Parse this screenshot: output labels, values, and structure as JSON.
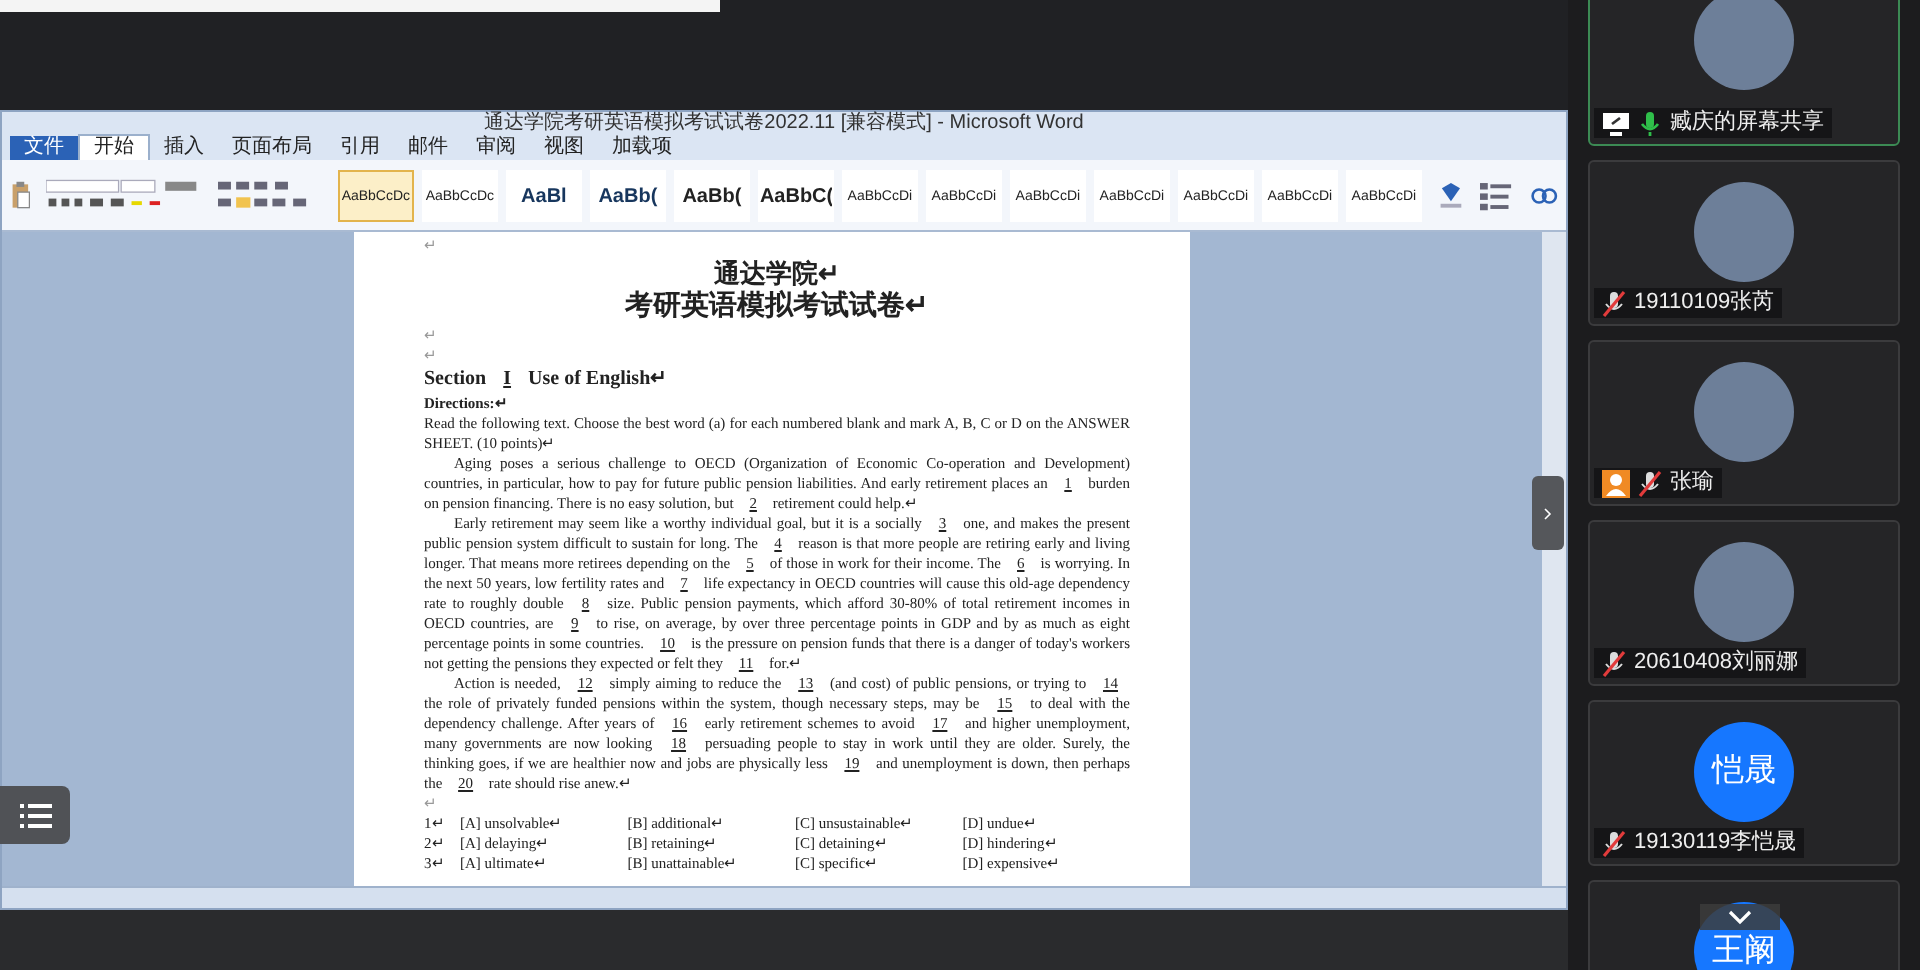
{
  "word": {
    "title": "通达学院考研英语模拟考试试卷2022.11 [兼容模式] - Microsoft Word",
    "tabs": [
      {
        "label": "文件",
        "kind": "file",
        "selected": false
      },
      {
        "label": "开始",
        "kind": "tab",
        "selected": true
      },
      {
        "label": "插入",
        "kind": "tab",
        "selected": false
      },
      {
        "label": "页面布局",
        "kind": "tab",
        "selected": false
      },
      {
        "label": "引用",
        "kind": "tab",
        "selected": false
      },
      {
        "label": "邮件",
        "kind": "tab",
        "selected": false
      },
      {
        "label": "审阅",
        "kind": "tab",
        "selected": false
      },
      {
        "label": "视图",
        "kind": "tab",
        "selected": false
      },
      {
        "label": "加载项",
        "kind": "tab",
        "selected": false
      }
    ],
    "styles": [
      {
        "preview": "AaBbCcDc",
        "selected": true
      },
      {
        "preview": "AaBbCcDc",
        "selected": false
      },
      {
        "preview": "AaBl",
        "selected": false
      },
      {
        "preview": "AaBb(",
        "selected": false
      },
      {
        "preview": "AaBb(",
        "selected": false
      },
      {
        "preview": "AaBbC(",
        "selected": false
      },
      {
        "preview": "AaBbCcDi",
        "selected": false
      },
      {
        "preview": "AaBbCcDi",
        "selected": false
      },
      {
        "preview": "AaBbCcDi",
        "selected": false
      },
      {
        "preview": "AaBbCcDi",
        "selected": false
      },
      {
        "preview": "AaBbCcDi",
        "selected": false
      },
      {
        "preview": "AaBbCcDi",
        "selected": false
      },
      {
        "preview": "AaBbCcDi",
        "selected": false
      }
    ],
    "document": {
      "top_mark": "↵",
      "school": "通达学院↵",
      "exam_title": "考研英语模拟考试试卷↵",
      "gap_marks": [
        "↵",
        "↵"
      ],
      "section": [
        {
          "text": "Section "
        },
        {
          "blank": "I"
        },
        {
          "text": " Use of English↵"
        }
      ],
      "directions_heading": "Directions:↵",
      "directions": "Read the following text. Choose the best word (a) for each numbered blank and mark A, B, C or D on the ANSWER SHEET. (10 points)↵",
      "paragraphs": [
        [
          {
            "text": "Aging poses a serious challenge to OECD (Organization of Economic Co-operation and Development) countries, in particular, how to pay for future public pension liabilities. And early retirement places an "
          },
          {
            "blank": "1"
          },
          {
            "text": " burden on pension financing. There is no easy solution, but "
          },
          {
            "blank": "2"
          },
          {
            "text": " retirement could help.↵"
          }
        ],
        [
          {
            "text": "Early retirement may seem like a worthy individual goal, but it is a socially "
          },
          {
            "blank": "3"
          },
          {
            "text": " one, and makes the present public pension system difficult to sustain for long. The "
          },
          {
            "blank": "4"
          },
          {
            "text": " reason is that more people are retiring early and living longer. That means more retirees depending on the "
          },
          {
            "blank": "5"
          },
          {
            "text": " of those in work for their income. The "
          },
          {
            "blank": "6"
          },
          {
            "text": " is worrying. In the next 50 years, low fertility rates and "
          },
          {
            "blank": "7"
          },
          {
            "text": " life expectancy in OECD countries will cause this old-age dependency rate to roughly double "
          },
          {
            "blank": "8"
          },
          {
            "text": " size. Public pension payments, which afford 30-80% of total retirement incomes in OECD countries, are "
          },
          {
            "blank": "9"
          },
          {
            "text": " to rise, on average, by over three percentage points in GDP and by as much as eight percentage points in some countries. "
          },
          {
            "blank": "10"
          },
          {
            "text": " is the pressure on pension funds that there is a danger of today's workers not getting the pensions they expected or felt they "
          },
          {
            "blank": "11"
          },
          {
            "text": " for.↵"
          }
        ],
        [
          {
            "text": "Action is needed, "
          },
          {
            "blank": "12"
          },
          {
            "text": " simply aiming to reduce the "
          },
          {
            "blank": "13"
          },
          {
            "text": " (and cost) of public pensions, or trying to "
          },
          {
            "blank": "14"
          },
          {
            "text": " the role of privately funded pensions within the system, though necessary steps, may be "
          },
          {
            "blank": "15"
          },
          {
            "text": " to deal with the dependency challenge. After years of "
          },
          {
            "blank": "16"
          },
          {
            "text": " early retirement schemes to avoid "
          },
          {
            "blank": "17"
          },
          {
            "text": " and higher unemployment, many governments are now looking "
          },
          {
            "blank": "18"
          },
          {
            "text": " persuading people to stay in work until they are older. Surely, the thinking goes, if we are healthier now and jobs are physically less "
          },
          {
            "blank": "19"
          },
          {
            "text": " and unemployment is down, then perhaps the "
          },
          {
            "blank": "20"
          },
          {
            "text": " rate should rise anew.↵"
          }
        ]
      ],
      "options_mark": "↵",
      "options": [
        {
          "number": "1↵",
          "choices": [
            "[A] unsolvable↵",
            "[B] additional↵",
            "[C] unsustainable↵",
            "[D] undue↵"
          ]
        },
        {
          "number": "2↵",
          "choices": [
            "[A] delaying↵",
            "[B] retaining↵",
            "[C] detaining↵",
            "[D] hindering↵"
          ]
        },
        {
          "number": "3↵",
          "choices": [
            "[A] ultimate↵",
            "[B] unattainable↵",
            "[C] specific↵",
            "[D] expensive↵"
          ]
        }
      ]
    }
  },
  "participants": [
    {
      "name": "臧庆的屏幕共享",
      "kind": "photo",
      "sharing": true,
      "person_icon": false,
      "muted": false,
      "highlighted": true
    },
    {
      "name": "19110109张芮",
      "kind": "photo",
      "sharing": false,
      "person_icon": false,
      "muted": true,
      "highlighted": false
    },
    {
      "name": "张瑜",
      "kind": "photo",
      "sharing": false,
      "person_icon": true,
      "muted": true,
      "highlighted": false
    },
    {
      "name": "20610408刘丽娜",
      "kind": "photo",
      "sharing": false,
      "person_icon": false,
      "muted": true,
      "highlighted": false
    },
    {
      "name": "19130119李恺晟",
      "kind": "initials",
      "avatar_text": "恺晟",
      "sharing": false,
      "person_icon": false,
      "muted": true,
      "highlighted": false
    },
    {
      "kind": "initials",
      "avatar_text": "王阚",
      "highlighted": false
    }
  ]
}
